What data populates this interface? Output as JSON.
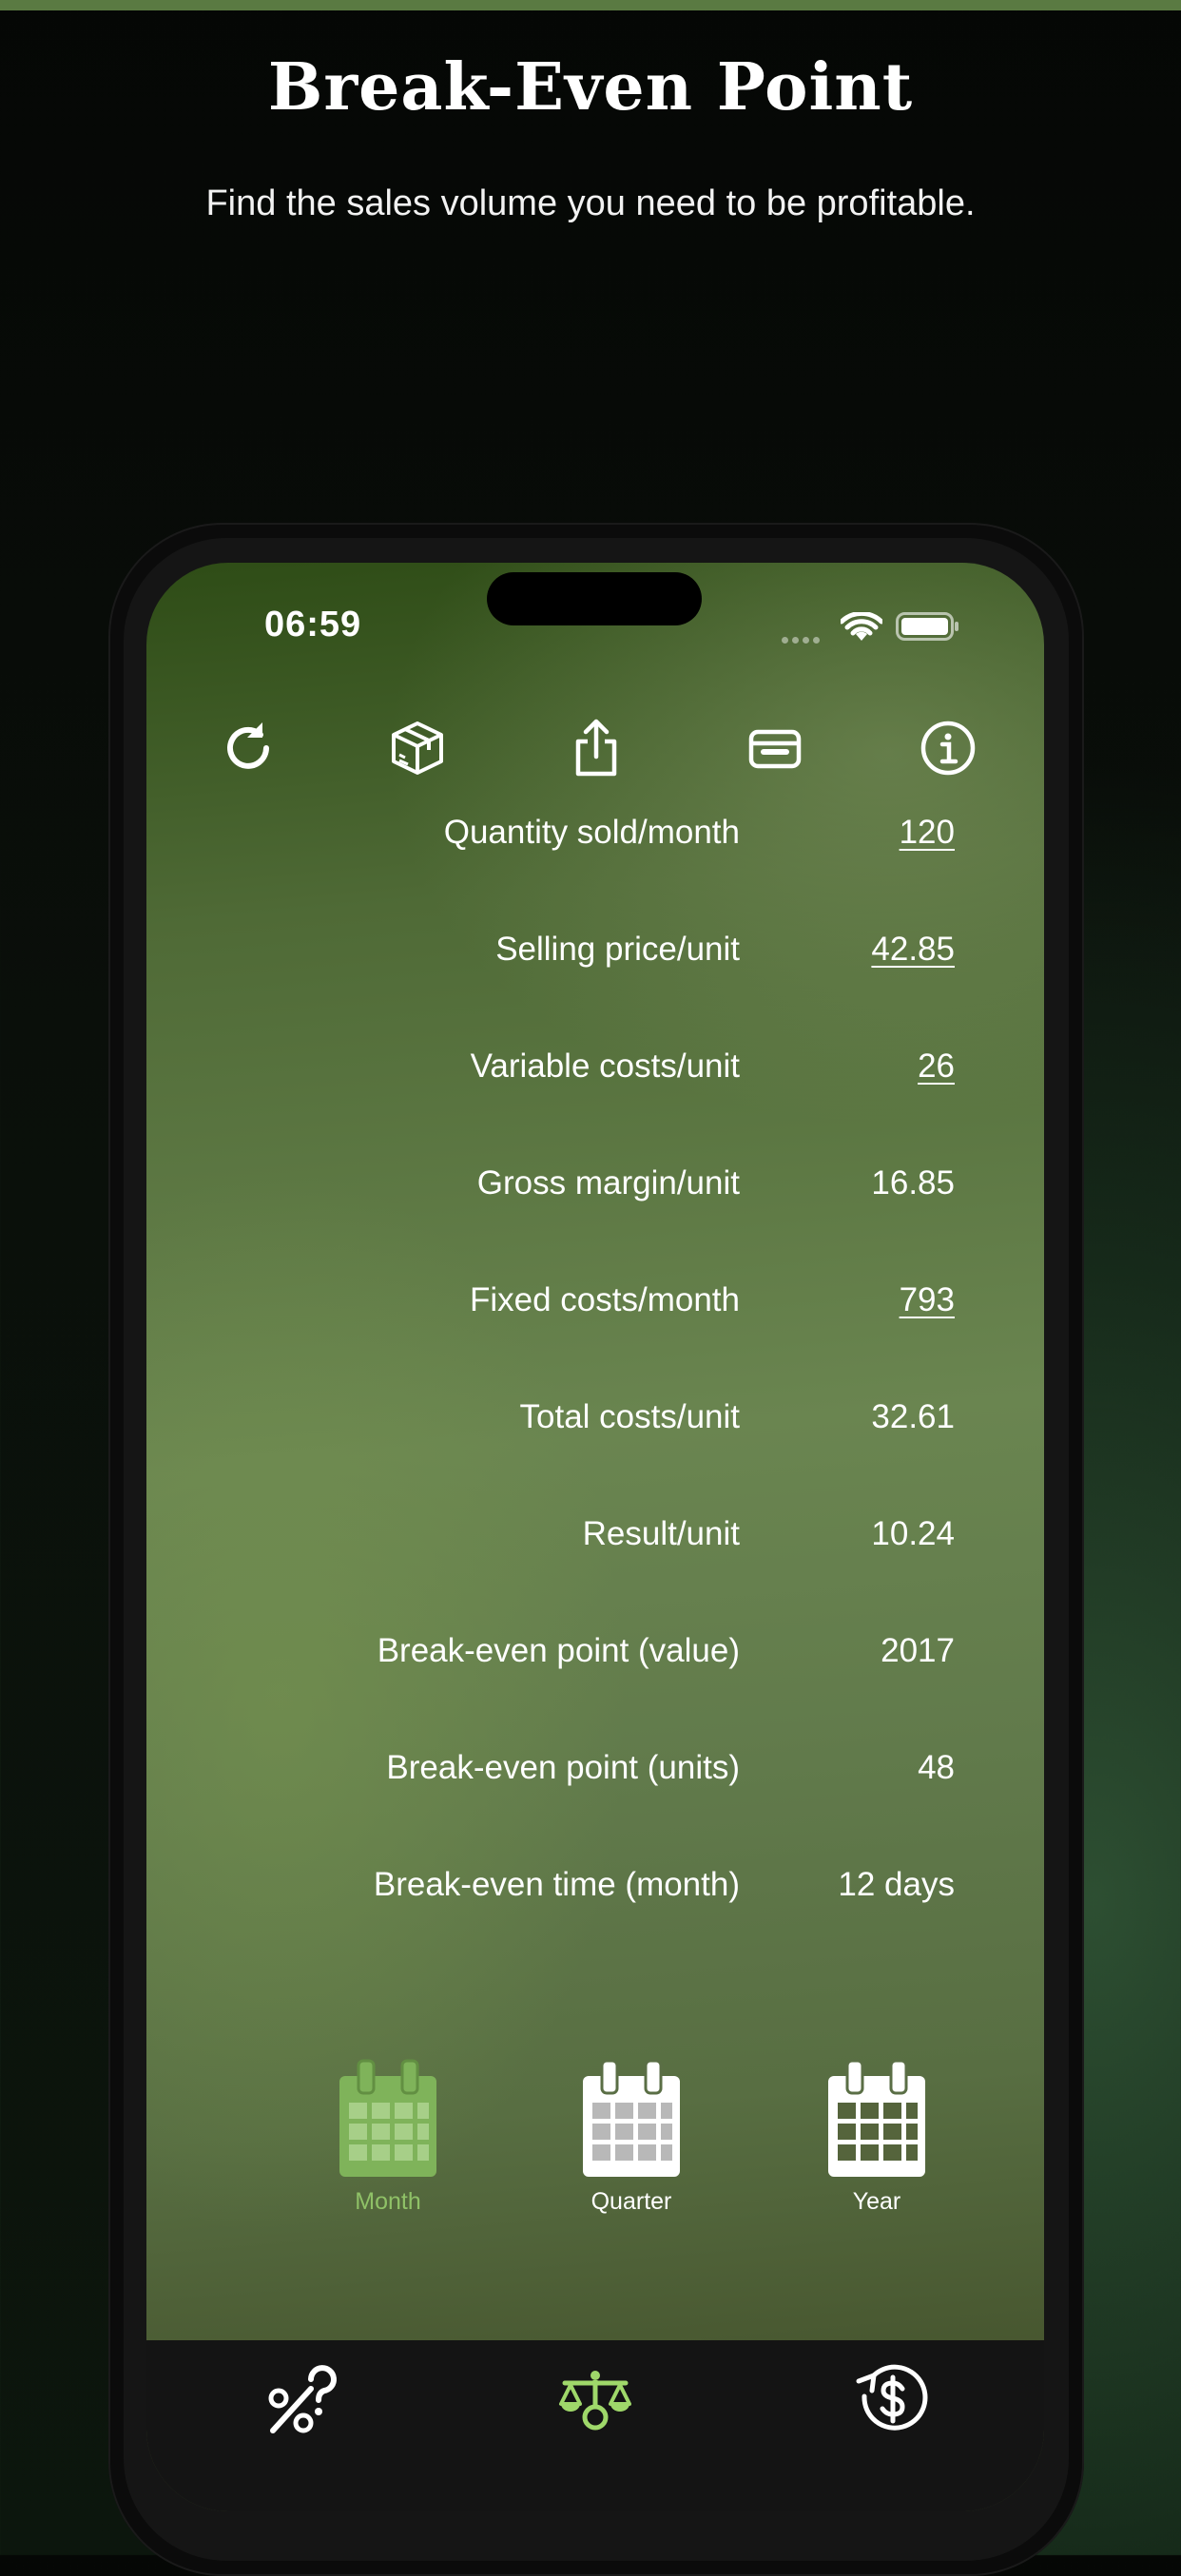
{
  "marketing": {
    "title": "Break-Even Point",
    "subtitle": "Find the sales volume you need to be profitable."
  },
  "status_bar": {
    "time": "06:59"
  },
  "toolbar": {
    "icons": [
      "refresh-icon",
      "package-icon",
      "share-icon",
      "archive-icon",
      "info-icon"
    ]
  },
  "rows": [
    {
      "label": "Quantity sold/month",
      "value": "120",
      "editable": true
    },
    {
      "label": "Selling price/unit",
      "value": "42.85",
      "editable": true
    },
    {
      "label": "Variable costs/unit",
      "value": "26",
      "editable": true
    },
    {
      "label": "Gross margin/unit",
      "value": "16.85",
      "editable": false
    },
    {
      "label": "Fixed costs/month",
      "value": "793",
      "editable": true
    },
    {
      "label": "Total costs/unit",
      "value": "32.61",
      "editable": false
    },
    {
      "label": "Result/unit",
      "value": "10.24",
      "editable": false
    },
    {
      "label": "Break-even point (value)",
      "value": "2017",
      "editable": false
    },
    {
      "label": "Break-even point (units)",
      "value": "48",
      "editable": false
    },
    {
      "label": "Break-even time (month)",
      "value": "12 days",
      "editable": false
    }
  ],
  "periods": [
    {
      "label": "Month",
      "selected": true
    },
    {
      "label": "Quarter",
      "selected": false
    },
    {
      "label": "Year",
      "selected": false
    }
  ],
  "tabbar": {
    "icons": [
      "percent-icon",
      "scale-icon",
      "dollar-clock-icon"
    ],
    "active_index": 1
  },
  "colors": {
    "accent_green": "#7fb35a",
    "tab_active": "#9fd86a",
    "tabbar_bg": "#141414",
    "top_strip": "#5a7a42"
  }
}
